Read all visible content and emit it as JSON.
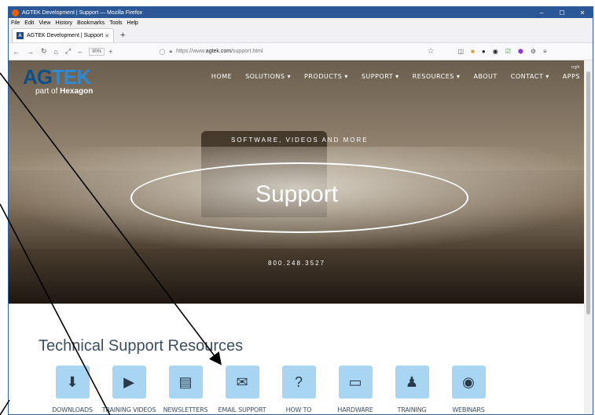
{
  "window": {
    "title": "AGTEK Development | Support — Mozilla Firefox"
  },
  "menu": [
    "File",
    "Edit",
    "View",
    "History",
    "Bookmarks",
    "Tools",
    "Help"
  ],
  "tab": {
    "label": "AGTEK Development | Support",
    "favicon": "A"
  },
  "nav": {
    "zoom": "90%",
    "url_prefix": "https://www.",
    "url_domain": "agtek.com",
    "url_path": "/support.html"
  },
  "site": {
    "logo_ag": "AG",
    "logo_tek": "TEK",
    "logo_sub_pre": "part of ",
    "logo_sub_brand": "Hexagon",
    "lang": "ngh",
    "nav_items": [
      "HOME",
      "SOLUTIONS ▾",
      "PRODUCTS ▾",
      "SUPPORT ▾",
      "RESOURCES ▾",
      "ABOUT",
      "CONTACT ▾",
      "APPS"
    ]
  },
  "hero": {
    "tagline": "SOFTWARE, VIDEOS AND MORE",
    "title": "Support",
    "phone": "800.248.3527"
  },
  "section": {
    "title": "Technical Support Resources"
  },
  "resources": [
    {
      "label": "DOWNLOADS",
      "icon": "download-icon",
      "glyph": "⬇"
    },
    {
      "label": "TRAINING VIDEOS",
      "icon": "video-icon",
      "glyph": "▶"
    },
    {
      "label": "NEWSLETTERS",
      "icon": "newsletter-icon",
      "glyph": "▤"
    },
    {
      "label": "EMAIL SUPPORT",
      "icon": "email-icon",
      "glyph": "✉"
    },
    {
      "label": "HOW TO",
      "icon": "howto-icon",
      "glyph": "?"
    },
    {
      "label": "HARDWARE",
      "icon": "monitor-icon",
      "glyph": "▭"
    },
    {
      "label": "TRAINING",
      "icon": "trainer-icon",
      "glyph": "♟"
    },
    {
      "label": "WEBINARS",
      "icon": "webinar-icon",
      "glyph": "◉"
    }
  ],
  "colors": {
    "titlebar": "#2b5797",
    "brand_dark": "#0d4f8b",
    "brand_light": "#2d8ad6",
    "icon_bg": "#a8d5f2"
  }
}
